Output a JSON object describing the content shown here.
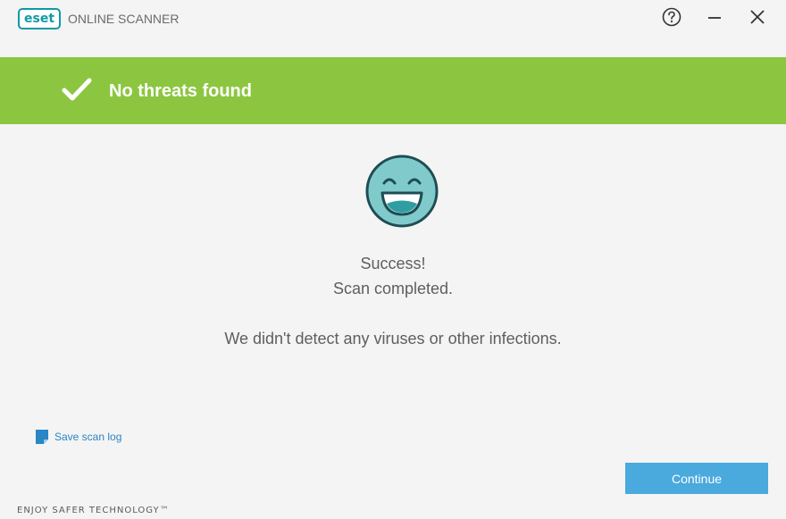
{
  "app": {
    "logo_text": "eset",
    "title": "ONLINE SCANNER"
  },
  "window_controls": {
    "help_icon": "question-circle-icon",
    "minimize_icon": "minimize-icon",
    "close_icon": "close-icon"
  },
  "banner": {
    "icon": "checkmark-icon",
    "message": "No threats found",
    "color": "#8cc640"
  },
  "result": {
    "icon": "smiley-face-icon",
    "line1": "Success!",
    "line2": "Scan completed.",
    "line3": "We didn't detect any viruses or other infections."
  },
  "actions": {
    "save_log_label": "Save scan log",
    "save_log_icon": "document-icon",
    "continue_label": "Continue",
    "continue_color": "#4aa9dd"
  },
  "footer": {
    "tagline": "ENJOY SAFER TECHNOLOGY™"
  }
}
